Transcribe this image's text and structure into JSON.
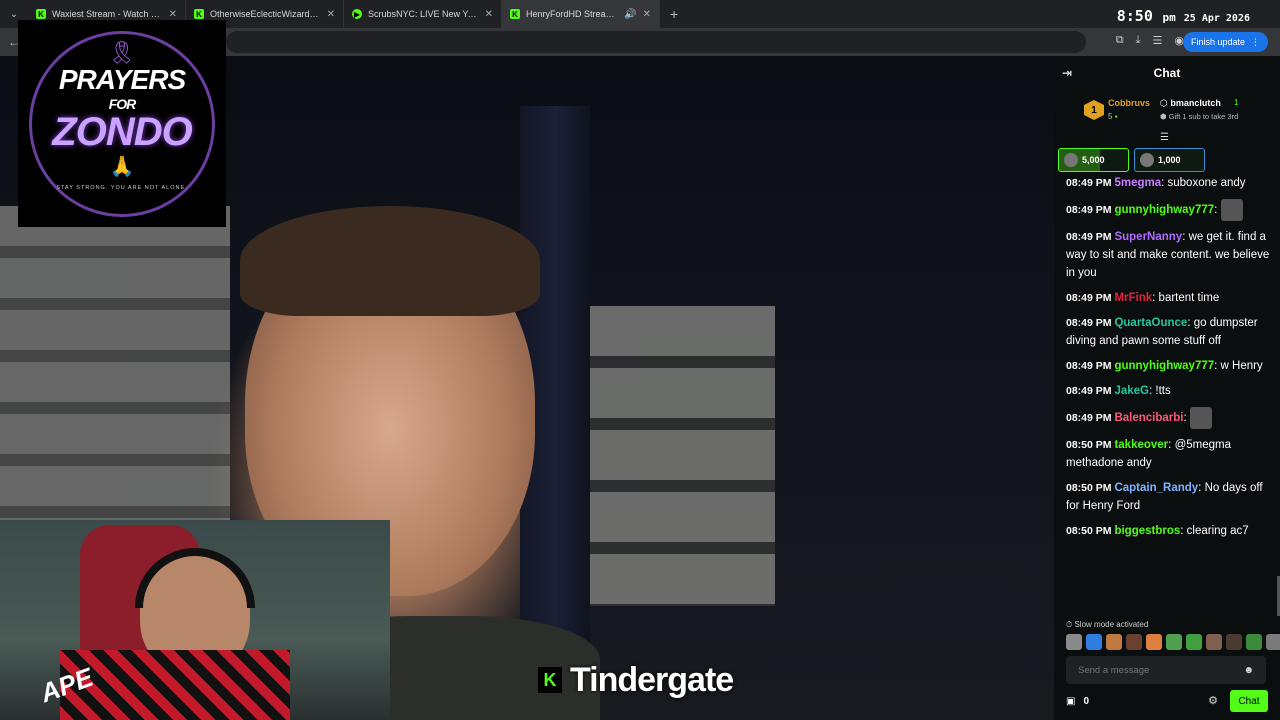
{
  "browser": {
    "tabs": [
      {
        "title": "Waxiest Stream - Watch Live on",
        "active": false
      },
      {
        "title": "OtherwiseEclecticWizard Stream",
        "active": false
      },
      {
        "title": "ScrubsNYC: LIVE New York",
        "active": false
      },
      {
        "title": "HenryFordHD Stream - Wa",
        "active": true
      }
    ],
    "new_tab": "+",
    "finish_update": "Finish update"
  },
  "clock": {
    "time": "8:50",
    "ampm": "pm",
    "date": "25 Apr 2026"
  },
  "logo": {
    "line1": "PRAYERS",
    "line2": "FOR",
    "line3": "ZONDO",
    "tagline": "STAY STRONG. YOU ARE NOT ALONE."
  },
  "overlay": {
    "caption": "Tindergate",
    "k_letter": "K"
  },
  "webcam": {
    "logo_text": "APE"
  },
  "chat": {
    "title": "Chat",
    "leaderboard": {
      "rank": "1",
      "first_name": "Cobbruvs",
      "first_score": "5",
      "second_name": "bmanclutch",
      "second_score": "1",
      "gift_text": "Gift 1 sub to take 3rd"
    },
    "goals": [
      {
        "value": "5,000",
        "progress": 0.6
      },
      {
        "value": "1,000",
        "progress": 0.0
      }
    ],
    "messages": [
      {
        "ts": "08:49 PM",
        "user": "5megma",
        "color": "#c77dff",
        "text": "suboxone andy"
      },
      {
        "ts": "08:49 PM",
        "user": "gunnyhighway777",
        "color": "#53fc18",
        "text": ""
      },
      {
        "ts": "08:49 PM",
        "user": "SuperNanny",
        "color": "#b26bff",
        "text": "we get it. find a way to sit and make content. we believe in you"
      },
      {
        "ts": "08:49 PM",
        "user": "MrFink",
        "color": "#e0243e",
        "text": "bartent time"
      },
      {
        "ts": "08:49 PM",
        "user": "QuartaOunce",
        "color": "#29c5a0",
        "text": "go dumpster diving and pawn some stuff off"
      },
      {
        "ts": "08:49 PM",
        "user": "gunnyhighway777",
        "color": "#53fc18",
        "text": "w Henry"
      },
      {
        "ts": "08:49 PM",
        "user": "JakeG",
        "color": "#29c5a0",
        "text": "!tts"
      },
      {
        "ts": "08:49 PM",
        "user": "Balencibarbi",
        "color": "#ff5a7a",
        "text": ""
      },
      {
        "ts": "08:50 PM",
        "user": "takkeover",
        "color": "#53fc18",
        "text": "@5megma methadone andy"
      },
      {
        "ts": "08:50 PM",
        "user": "Captain_Randy",
        "color": "#7fb3ff",
        "text": "No days off for Henry Ford"
      },
      {
        "ts": "08:50 PM",
        "user": "biggestbros",
        "color": "#53fc18",
        "text": "clearing ac7"
      }
    ],
    "slow_mode": "Slow mode activated",
    "input_placeholder": "Send a message",
    "viewer_count": "0",
    "chat_button": "Chat"
  },
  "colors": {
    "kick_green": "#53fc18",
    "chat_bg": "#0b0e0f",
    "tabbar": "#202124"
  }
}
